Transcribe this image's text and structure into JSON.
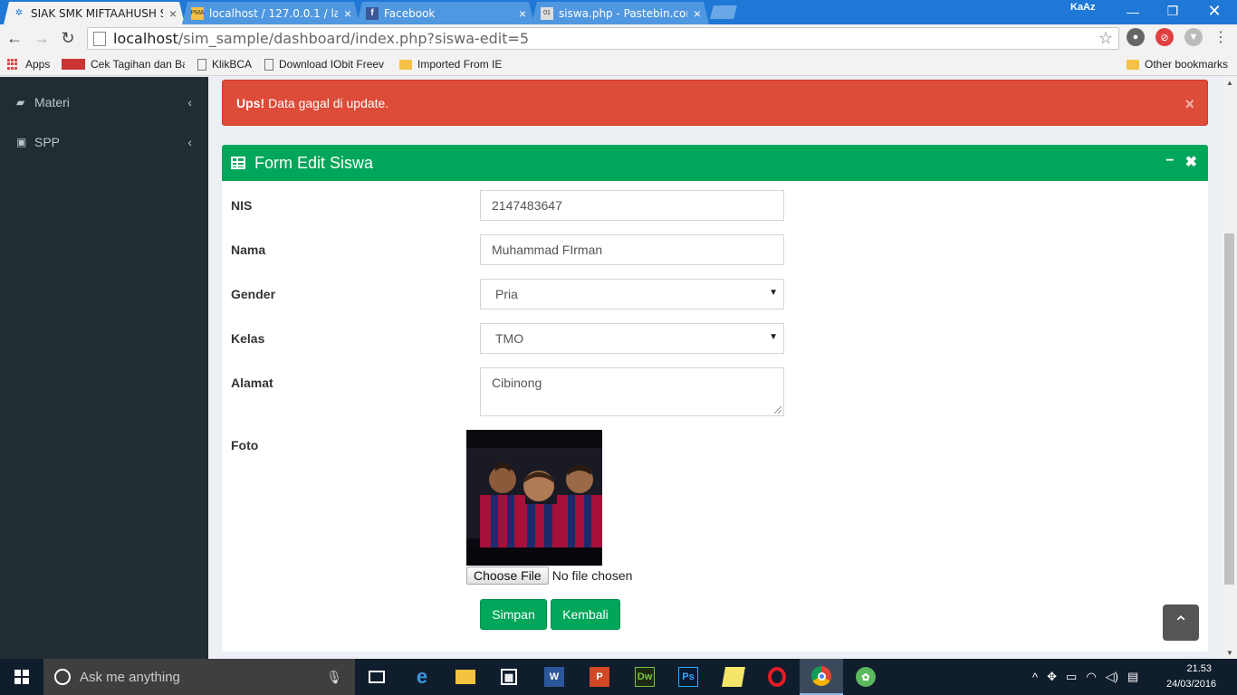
{
  "browser": {
    "tabs": [
      {
        "title": "SIAK SMK MIFTAAHUSH S",
        "active": true
      },
      {
        "title": "localhost / 127.0.0.1 / lab",
        "active": false
      },
      {
        "title": "Facebook",
        "active": false
      },
      {
        "title": "siswa.php - Pastebin.com",
        "active": false
      }
    ],
    "profile_name": "KaAz",
    "url_host": "localhost",
    "url_path": "/sim_sample/dashboard/index.php?siswa-edit=5",
    "bookmarks": [
      "Apps",
      "Cek Tagihan dan Ba",
      "KlikBCA",
      "Download IObit Freev",
      "Imported From IE"
    ],
    "other_bookmarks": "Other bookmarks",
    "accent_color": "#1f78d6"
  },
  "sidebar": {
    "items": [
      {
        "label": "Materi",
        "icon": "book-icon"
      },
      {
        "label": "SPP",
        "icon": "money-icon"
      }
    ]
  },
  "alert": {
    "strong": "Ups!",
    "message": "Data gagal di update.",
    "color": "#dd4b39"
  },
  "form": {
    "title": "Form Edit Siswa",
    "header_color": "#00a65a",
    "fields": {
      "nis": {
        "label": "NIS",
        "value": "2147483647"
      },
      "nama": {
        "label": "Nama",
        "value": "Muhammad FIrman"
      },
      "gender": {
        "label": "Gender",
        "value": "Pria"
      },
      "kelas": {
        "label": "Kelas",
        "value": "TMO"
      },
      "alamat": {
        "label": "Alamat",
        "value": "Cibinong"
      },
      "foto": {
        "label": "Foto",
        "choose_label": "Choose File",
        "status": "No file chosen"
      }
    },
    "buttons": {
      "save": "Simpan",
      "back": "Kembali"
    }
  },
  "taskbar": {
    "search_placeholder": "Ask me anything",
    "time": "21.53",
    "date": "24/03/2016"
  }
}
